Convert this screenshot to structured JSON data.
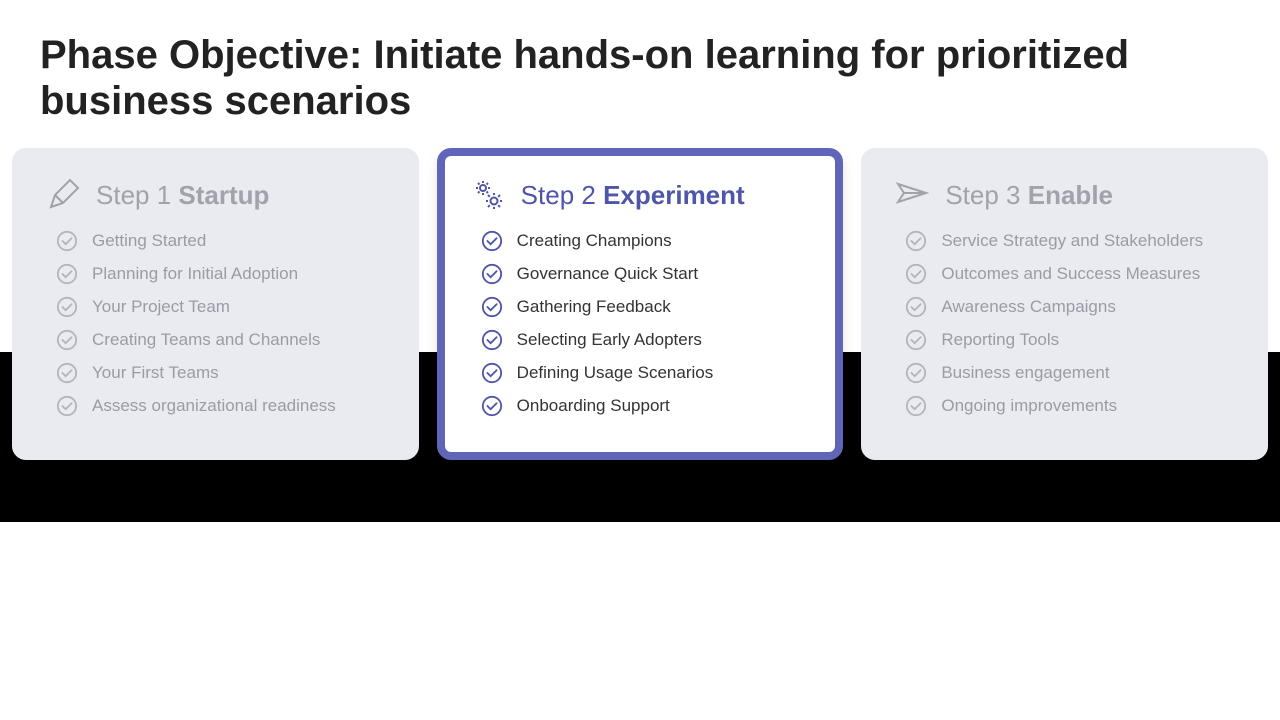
{
  "title": "Phase Objective: Initiate hands-on learning for prioritized business scenarios",
  "steps": [
    {
      "prefix": "Step 1 ",
      "name": "Startup",
      "icon": "pencil-icon",
      "active": false,
      "items": [
        "Getting Started",
        "Planning for Initial Adoption",
        "Your Project Team",
        "Creating Teams and Channels",
        "Your First Teams",
        "Assess organizational readiness"
      ]
    },
    {
      "prefix": "Step 2 ",
      "name": "Experiment",
      "icon": "gears-icon",
      "active": true,
      "items": [
        "Creating Champions",
        "Governance Quick Start",
        "Gathering Feedback",
        "Selecting Early Adopters",
        "Defining Usage Scenarios",
        "Onboarding Support"
      ]
    },
    {
      "prefix": "Step 3 ",
      "name": "Enable",
      "icon": "send-icon",
      "active": false,
      "items": [
        "Service Strategy and Stakeholders",
        "Outcomes and Success Measures",
        "Awareness Campaigns",
        "Reporting Tools",
        "Business engagement",
        "Ongoing improvements"
      ]
    }
  ]
}
